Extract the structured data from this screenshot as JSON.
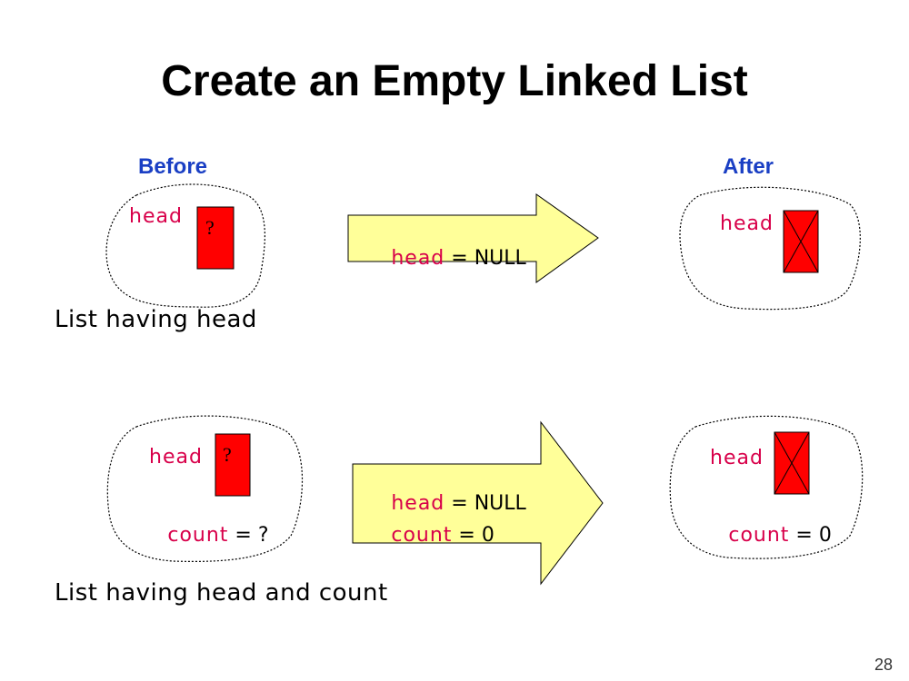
{
  "title": "Create an Empty Linked List",
  "labels": {
    "before": "Before",
    "after": "After"
  },
  "top": {
    "before_field": "head",
    "before_value": "?",
    "arrow_field": "head",
    "arrow_value": " = NULL",
    "after_field": "head",
    "caption": "List having head"
  },
  "bottom": {
    "before_head": "head",
    "before_head_value": "?",
    "before_count": "count",
    "before_count_value": " = ?",
    "arrow_head": "head",
    "arrow_head_value": " = NULL",
    "arrow_count": "count",
    "arrow_count_value": " = 0",
    "after_head": "head",
    "after_count": "count",
    "after_count_value": " = 0",
    "caption": "List having head and count"
  },
  "page_number": "28",
  "colors": {
    "title": "#000000",
    "heading_blue": "#1a3fc4",
    "field_red": "#d8004a",
    "box_red": "#ff0000",
    "arrow_fill": "#ffff99"
  }
}
